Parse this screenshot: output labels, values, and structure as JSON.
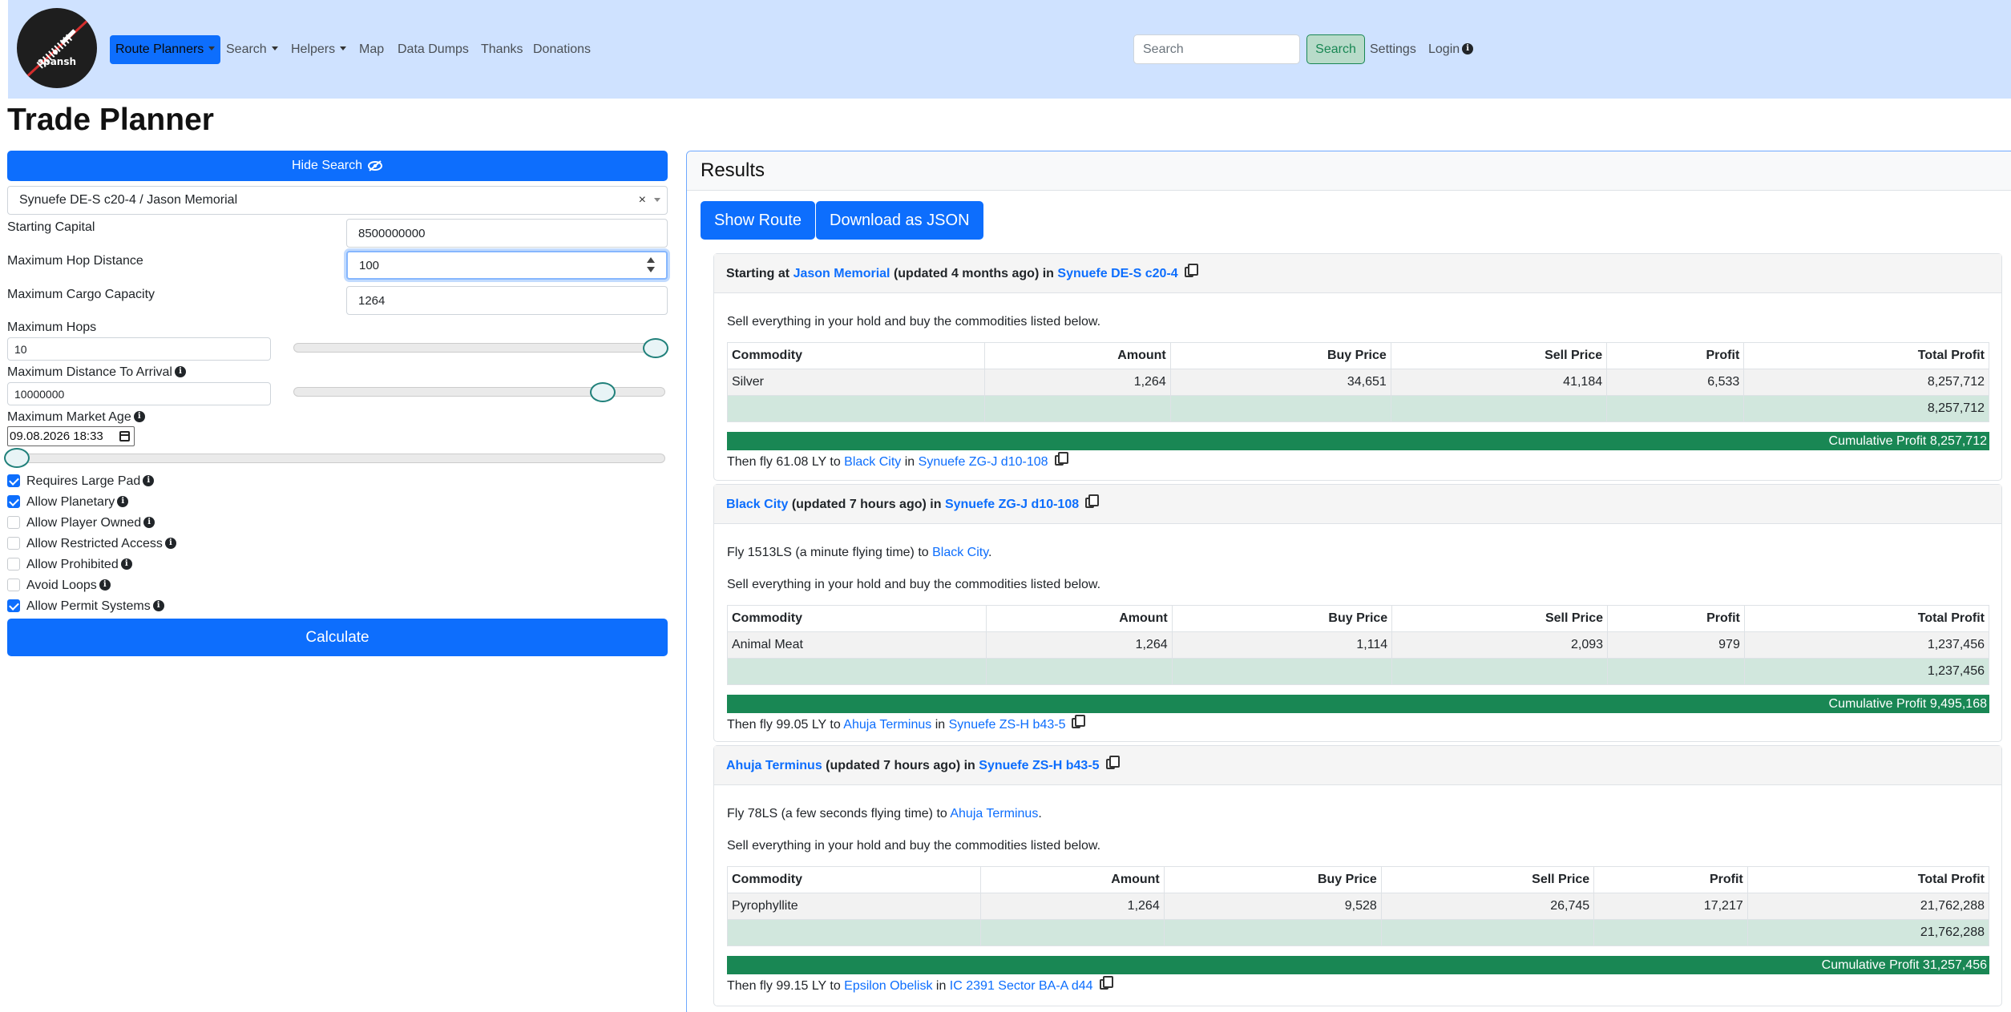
{
  "nav": {
    "logo_text": "spansh",
    "items": [
      {
        "label": "Route Planners",
        "dropdown": true,
        "active": true
      },
      {
        "label": "Search",
        "dropdown": true
      },
      {
        "label": "Helpers",
        "dropdown": true
      },
      {
        "label": "Map"
      },
      {
        "label": "Data Dumps"
      },
      {
        "label": "Thanks"
      },
      {
        "label": "Donations"
      }
    ],
    "search_placeholder": "Search",
    "search_button": "Search",
    "settings": "Settings",
    "login": "Login",
    "info_glyph": "i"
  },
  "page_title": "Trade Planner",
  "form": {
    "hide_search": "Hide Search",
    "hide_icon": "eye-slash-icon",
    "station_select": "Synuefe DE-S c20-4 / Jason Memorial",
    "clear_glyph": "×",
    "starting_capital": {
      "label": "Starting Capital",
      "value": "8500000000"
    },
    "max_hop_distance": {
      "label": "Maximum Hop Distance",
      "value": "100"
    },
    "max_cargo": {
      "label": "Maximum Cargo Capacity",
      "value": "1264"
    },
    "max_hops": {
      "label": "Maximum Hops",
      "value": "10",
      "slider_fraction": 1.0
    },
    "max_distance_arrival": {
      "label": "Maximum Distance To Arrival",
      "value": "10000000",
      "slider_fraction": 0.85
    },
    "max_market_age": {
      "label": "Maximum Market Age",
      "value": "09.08.2026 18:33",
      "slider_fraction": 0.0
    },
    "checkboxes": [
      {
        "label": "Requires Large Pad",
        "checked": true
      },
      {
        "label": "Allow Planetary",
        "checked": true
      },
      {
        "label": "Allow Player Owned",
        "checked": false
      },
      {
        "label": "Allow Restricted Access",
        "checked": false
      },
      {
        "label": "Allow Prohibited",
        "checked": false
      },
      {
        "label": "Avoid Loops",
        "checked": false
      },
      {
        "label": "Allow Permit Systems",
        "checked": true
      }
    ],
    "calculate": "Calculate"
  },
  "results": {
    "title": "Results",
    "show_route": "Show Route",
    "download_json": "Download as JSON",
    "table_headers": [
      "Commodity",
      "Amount",
      "Buy Price",
      "Sell Price",
      "Profit",
      "Total Profit"
    ],
    "hops": [
      {
        "head_prefix": "Starting at ",
        "station": "Jason Memorial",
        "updated": " (updated 4 months ago) in ",
        "system": "Synuefe DE-S c20-4",
        "fly_text": null,
        "sell_text": "Sell everything in your hold and buy the commodities listed below.",
        "rows": [
          [
            "Silver",
            "1,264",
            "34,651",
            "41,184",
            "6,533",
            "8,257,712"
          ]
        ],
        "total": "8,257,712",
        "cumulative": "Cumulative Profit 8,257,712",
        "next": {
          "prefix": "Then fly 61.08 LY to ",
          "station": "Black City",
          "mid": " in ",
          "system": "Synuefe ZG-J d10-108"
        }
      },
      {
        "head_prefix": "",
        "station": "Black City",
        "updated": " (updated 7 hours ago) in ",
        "system": "Synuefe ZG-J d10-108",
        "fly_text": {
          "prefix": "Fly 1513LS (a minute flying time) to ",
          "station": "Black City",
          "suffix": "."
        },
        "sell_text": "Sell everything in your hold and buy the commodities listed below.",
        "rows": [
          [
            "Animal Meat",
            "1,264",
            "1,114",
            "2,093",
            "979",
            "1,237,456"
          ]
        ],
        "total": "1,237,456",
        "cumulative": "Cumulative Profit 9,495,168",
        "next": {
          "prefix": "Then fly 99.05 LY to ",
          "station": "Ahuja Terminus",
          "mid": " in ",
          "system": "Synuefe ZS-H b43-5"
        }
      },
      {
        "head_prefix": "",
        "station": "Ahuja Terminus",
        "updated": " (updated 7 hours ago) in ",
        "system": "Synuefe ZS-H b43-5",
        "fly_text": {
          "prefix": "Fly 78LS (a few seconds flying time) to ",
          "station": "Ahuja Terminus",
          "suffix": "."
        },
        "sell_text": "Sell everything in your hold and buy the commodities listed below.",
        "rows": [
          [
            "Pyrophyllite",
            "1,264",
            "9,528",
            "26,745",
            "17,217",
            "21,762,288"
          ]
        ],
        "total": "21,762,288",
        "cumulative": "Cumulative Profit 31,257,456",
        "next": {
          "prefix": "Then fly 99.15 LY to ",
          "station": "Epsilon Obelisk",
          "mid": " in ",
          "system": "IC 2391 Sector BA-A d44"
        }
      }
    ]
  },
  "colors": {
    "primary": "#0d6efd",
    "navbar_bg": "#cfe2ff",
    "success": "#198754",
    "sum_row": "#d1e7dd"
  }
}
